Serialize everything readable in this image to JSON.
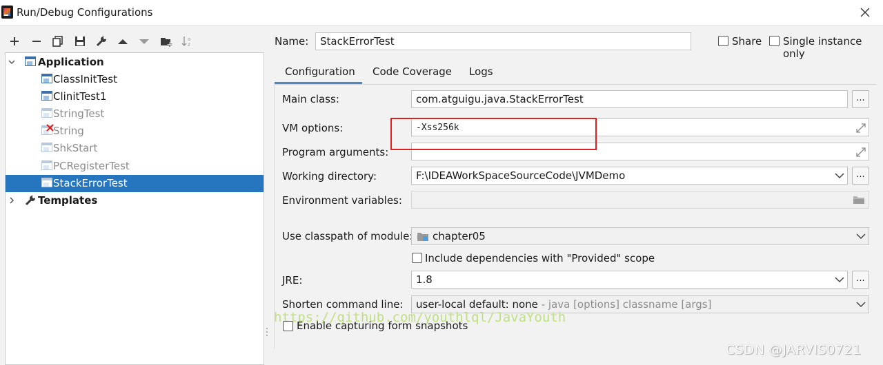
{
  "window": {
    "title": "Run/Debug Configurations"
  },
  "toolbar": {
    "icons": [
      "add-icon",
      "remove-icon",
      "copy-icon",
      "save-icon",
      "wrench-icon",
      "move-up-icon",
      "move-down-icon",
      "folder-add-icon",
      "sort-icon"
    ]
  },
  "tree": {
    "application": {
      "label": "Application"
    },
    "items": [
      {
        "label": "ClassInitTest",
        "state": "normal"
      },
      {
        "label": "ClinitTest1",
        "state": "normal"
      },
      {
        "label": "StringTest",
        "state": "dim"
      },
      {
        "label": "String",
        "state": "error"
      },
      {
        "label": "ShkStart",
        "state": "dim"
      },
      {
        "label": "PCRegisterTest",
        "state": "dim"
      },
      {
        "label": "StackErrorTest",
        "state": "selected"
      }
    ],
    "templates": {
      "label": "Templates"
    }
  },
  "header": {
    "name_label": "Name:",
    "name_value": "StackErrorTest",
    "share_label": "Share",
    "single_instance_label": "Single instance only"
  },
  "tabs": [
    {
      "label": "Configuration",
      "active": true
    },
    {
      "label": "Code Coverage",
      "active": false
    },
    {
      "label": "Logs",
      "active": false
    }
  ],
  "form": {
    "main_class": {
      "label": "Main class:",
      "value": "com.atguigu.java.StackErrorTest"
    },
    "vm_options": {
      "label": "VM options:",
      "value": "-Xss256k"
    },
    "program_arguments": {
      "label": "Program arguments:",
      "value": ""
    },
    "working_directory": {
      "label": "Working directory:",
      "value": "F:\\IDEAWorkSpaceSourceCode\\JVMDemo"
    },
    "environment_variables": {
      "label": "Environment variables:",
      "value": ""
    },
    "classpath_module": {
      "label": "Use classpath of module:",
      "value": "chapter05"
    },
    "include_dependencies": {
      "label": "Include dependencies with \"Provided\" scope",
      "checked": false
    },
    "jre": {
      "label": "JRE:",
      "value": "1.8"
    },
    "shorten_command_line": {
      "label": "Shorten command line:",
      "value": "user-local default: none",
      "hint": " - java [options] classname [args]"
    },
    "capture_snapshots": {
      "label": "Enable capturing form snapshots",
      "checked": false
    },
    "browse_label": "..."
  },
  "overlays": {
    "watermark": "https://github.com/youthlql/JavaYouth",
    "csdn": "CSDN @JARVIS0721",
    "highlight_color": "#e02020"
  },
  "colors": {
    "selection": "#2675bf",
    "accent": "#4a88c7"
  }
}
